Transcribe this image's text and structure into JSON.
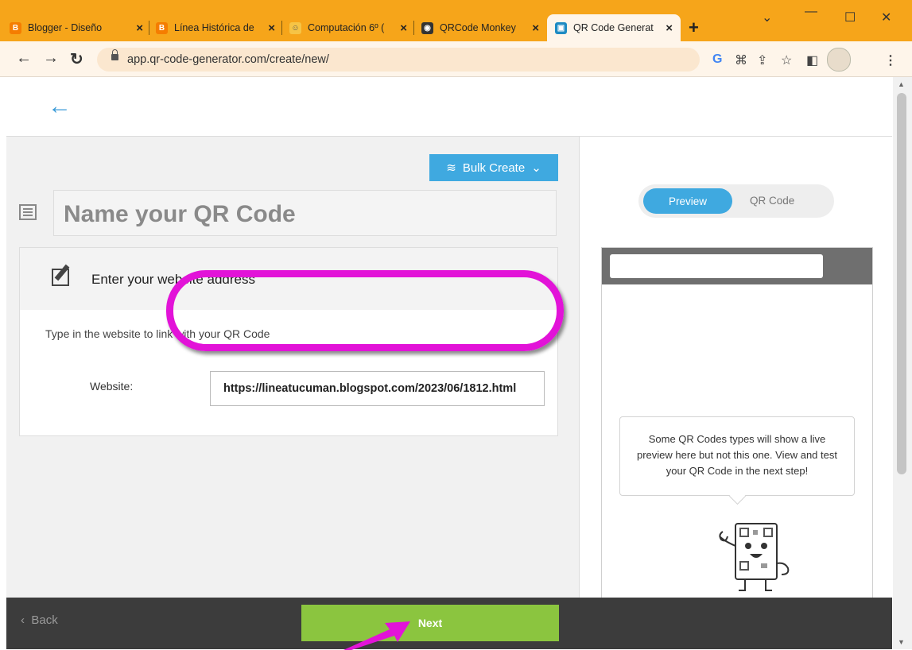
{
  "browser": {
    "tabs": [
      {
        "label": "Blogger - Diseño",
        "favicon": "blogger-icon",
        "color": "#f57d00",
        "glyph": "B"
      },
      {
        "label": "Línea Histórica de",
        "favicon": "blogger-icon",
        "color": "#f57d00",
        "glyph": "B"
      },
      {
        "label": "Computación 6º (",
        "favicon": "classroom-icon",
        "color": "#f6c445",
        "glyph": "☺"
      },
      {
        "label": "QRCode Monkey",
        "favicon": "monkey-icon",
        "color": "#333333",
        "glyph": "◉"
      },
      {
        "label": "QR Code Generat",
        "favicon": "qr-generator-icon",
        "color": "#1e8bc3",
        "glyph": "▣"
      }
    ],
    "url": "app.qr-code-generator.com/create/new/"
  },
  "page": {
    "bulk_create": "Bulk Create",
    "name_placeholder": "Name your QR Code",
    "card_title": "Enter your website address",
    "card_desc": "Type in the website to link with your QR Code",
    "website_label": "Website:",
    "website_value": "https://lineatucuman.blogspot.com/2023/06/1812.html",
    "preview_tab": "Preview",
    "qr_tab": "QR Code",
    "preview_message": "Some QR Codes types will show a live preview here but not this one. View and test your QR Code in the next step!",
    "back": "Back",
    "next": "Next"
  },
  "colors": {
    "tabstrip": "#f6a51a",
    "accent_blue": "#3fa9e0",
    "next_green": "#8bc53f",
    "highlight_magenta": "#e213d8"
  }
}
